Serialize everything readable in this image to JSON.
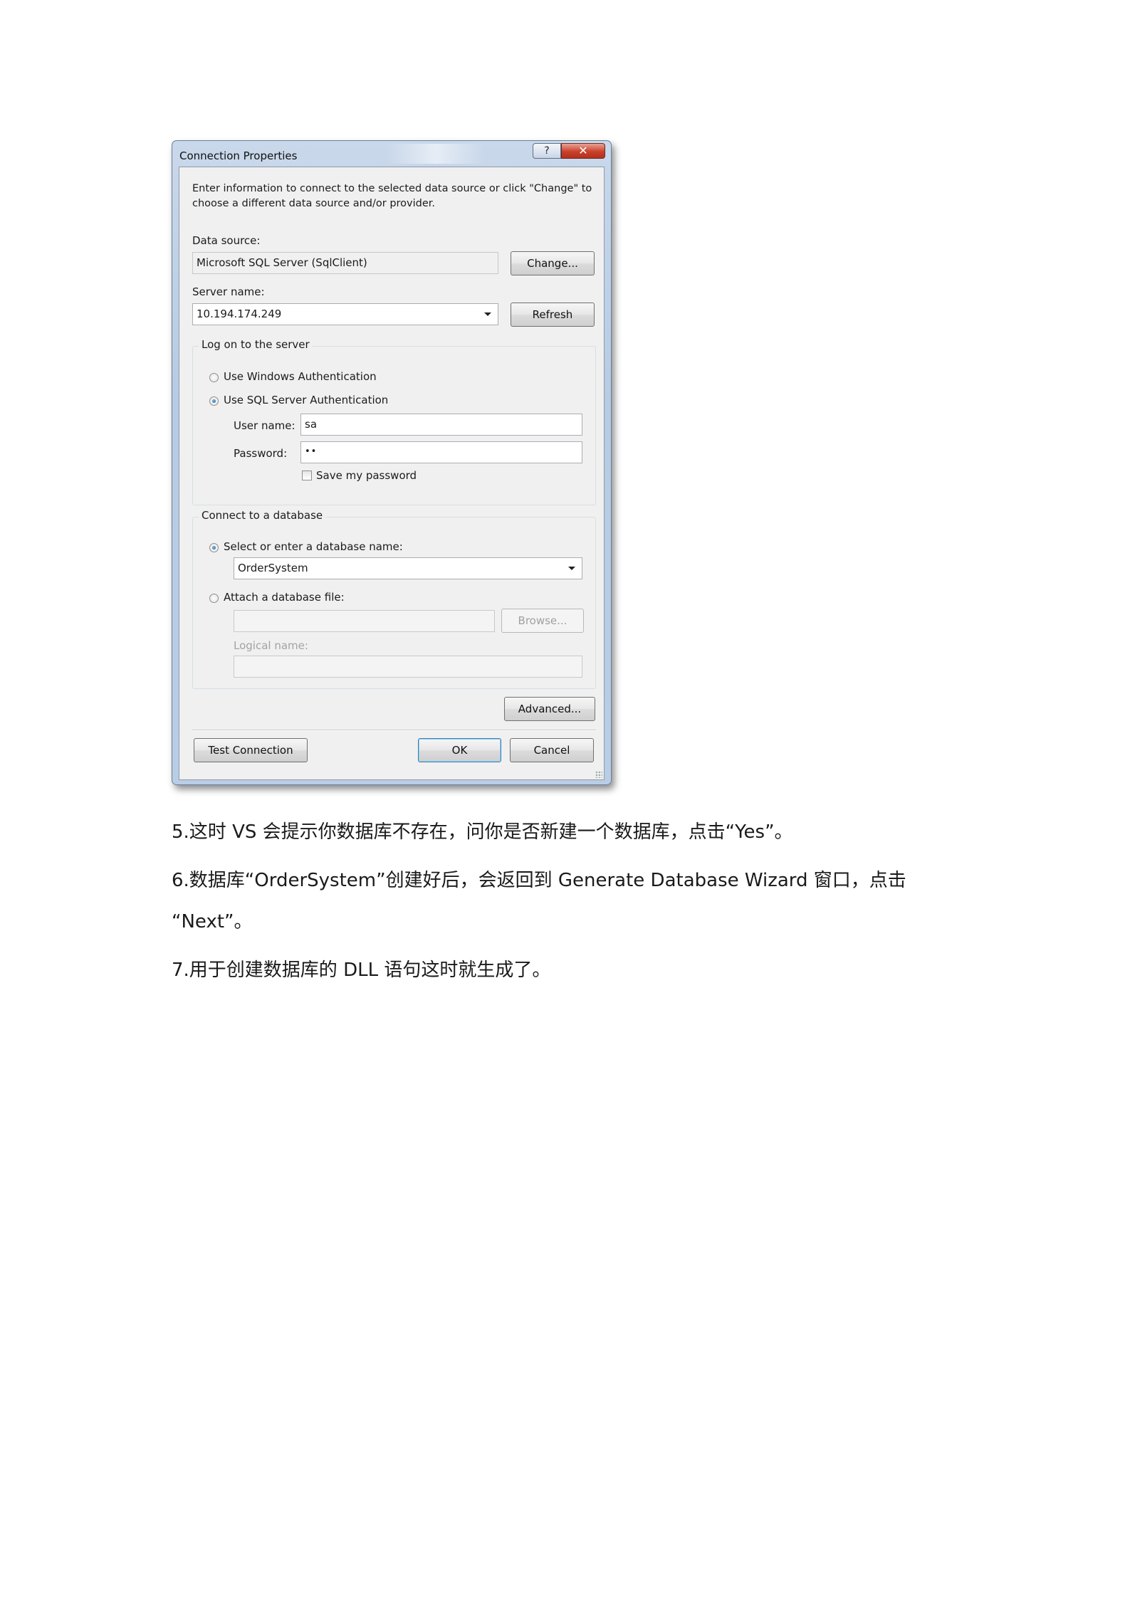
{
  "dialog": {
    "title": "Connection Properties",
    "help_glyph": "?",
    "close_glyph": "✕",
    "intro": "Enter information to connect to the selected data source or click \"Change\" to choose a different data source and/or provider.",
    "data_source": {
      "label": "Data source:",
      "value": "Microsoft SQL Server (SqlClient)",
      "change_button": "Change..."
    },
    "server": {
      "label": "Server name:",
      "value": "10.194.174.249",
      "refresh_button": "Refresh"
    },
    "logon": {
      "legend": "Log on to the server",
      "windows_auth": "Use Windows Authentication",
      "sql_auth": "Use SQL Server Authentication",
      "selected": "sql",
      "user_label": "User name:",
      "user_value": "sa",
      "password_label": "Password:",
      "password_value": "••",
      "save_password": "Save my password"
    },
    "database": {
      "legend": "Connect to a database",
      "select_label": "Select or enter a database name:",
      "select_value": "OrderSystem",
      "attach_label": "Attach a database file:",
      "browse_button": "Browse...",
      "logical_label": "Logical name:"
    },
    "advanced_button": "Advanced...",
    "test_button": "Test Connection",
    "ok_button": "OK",
    "cancel_button": "Cancel"
  },
  "paragraphs": {
    "p5": "5.这时 VS 会提示你数据库不存在，问你是否新建一个数据库，点击“Yes”。",
    "p6_line1": "6.数据库“OrderSystem”创建好后，会返回到 Generate Database Wizard 窗口，点击",
    "p6_line2": "“Next”。",
    "p7": "7.用于创建数据库的 DLL 语句这时就生成了。"
  }
}
